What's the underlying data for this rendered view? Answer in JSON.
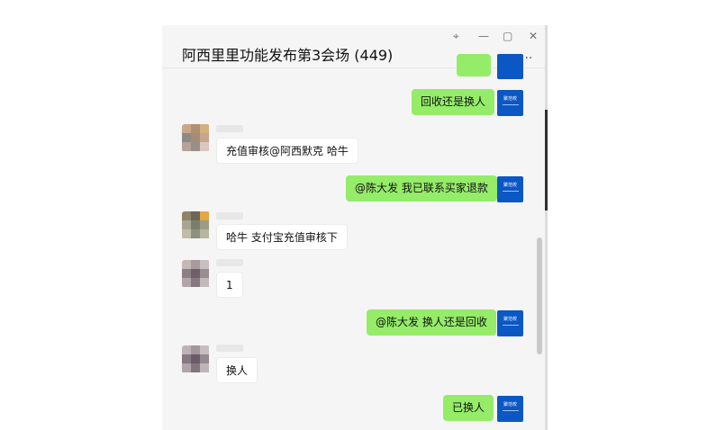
{
  "window": {
    "title": "阿西里里功能发布第3会场 (449)",
    "more": "...",
    "controls": {
      "pin": "⌖",
      "minimize": "—",
      "maximize": "▢",
      "close": "✕"
    }
  },
  "me": {
    "avatar_text": "聚范校"
  },
  "messages": [
    {
      "id": "m1",
      "dir": "out",
      "text": "回收还是换人"
    },
    {
      "id": "m2",
      "dir": "in",
      "text": "充值审核@阿西默克   哈牛"
    },
    {
      "id": "m3",
      "dir": "out",
      "text": "@陈大发 我已联系买家退款"
    },
    {
      "id": "m4",
      "dir": "in",
      "text": "哈牛 支付宝充值审核下"
    },
    {
      "id": "m5",
      "dir": "in",
      "text": "1"
    },
    {
      "id": "m6",
      "dir": "out",
      "text": "@陈大发 换人还是回收"
    },
    {
      "id": "m7",
      "dir": "in",
      "text": "换人"
    },
    {
      "id": "m8",
      "dir": "out",
      "text": "已换人"
    }
  ],
  "colors": {
    "out_bubble": "#95ec69",
    "in_bubble": "#ffffff",
    "my_avatar": "#0b57c4"
  },
  "icons": [
    "pin-icon",
    "minimize-icon",
    "maximize-icon",
    "close-icon",
    "more-icon"
  ]
}
